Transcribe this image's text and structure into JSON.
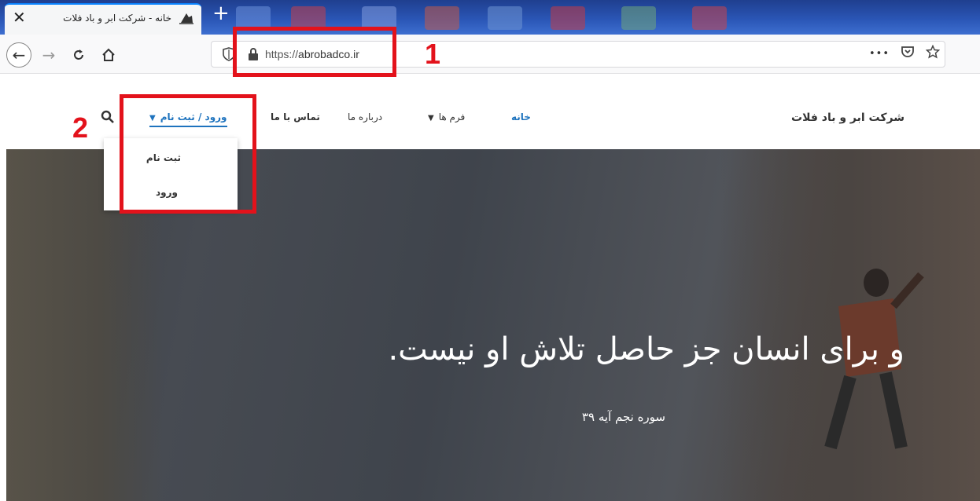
{
  "browser": {
    "tab": {
      "title": "خانه - شرکت ابر و باد فلات",
      "close_icon": "close-icon"
    },
    "new_tab_label": "+",
    "url": {
      "protocol": "https://",
      "domain": "abrobadco.ir"
    },
    "url_actions": {
      "more": "•••"
    }
  },
  "site": {
    "brand": "شرکت ابر و باد فلات",
    "menu": {
      "home": "خانه",
      "forms": "فرم ها",
      "about": "درباره ما",
      "contact": "تماس با ما",
      "login_register": "ورود / ثبت نام"
    },
    "dropdown": {
      "register": "ثبت نام",
      "login": "ورود"
    },
    "hero": {
      "title": "و برای انسان جز حاصل تلاش او نیست.",
      "subtitle": "سوره نجم آیه ۳۹"
    }
  },
  "annotations": {
    "label_1": "1",
    "label_2": "2",
    "color": "#e3121b"
  },
  "colors": {
    "accent": "#1e73be",
    "tabstrip": "#2a55b5"
  }
}
